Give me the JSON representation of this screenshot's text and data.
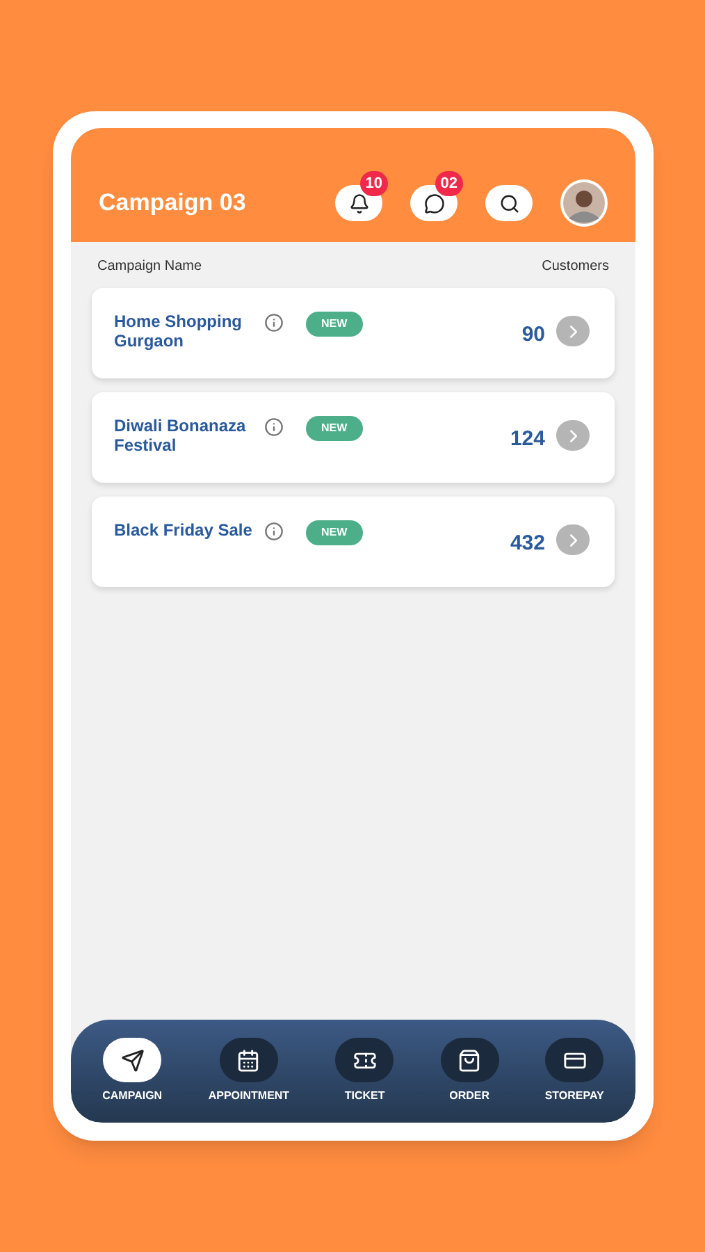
{
  "header": {
    "title": "Campaign 03",
    "notifications": "10",
    "messages": "02"
  },
  "columns": [
    "Campaign Name",
    "Customers"
  ],
  "campaigns": [
    {
      "name": "Home Shopping Gurgaon",
      "badge": "NEW",
      "customers": "90"
    },
    {
      "name": "Diwali Bonanaza Festival",
      "badge": "NEW",
      "customers": "124"
    },
    {
      "name": "Black Friday Sale",
      "badge": "NEW",
      "customers": "432"
    }
  ],
  "nav": [
    {
      "label": "CAMPAIGN",
      "selected": true
    },
    {
      "label": "APPOINTMENT",
      "selected": false
    },
    {
      "label": "TICKET",
      "selected": false
    },
    {
      "label": "ORDER",
      "selected": false
    },
    {
      "label": "STOREPAY",
      "selected": false
    }
  ]
}
